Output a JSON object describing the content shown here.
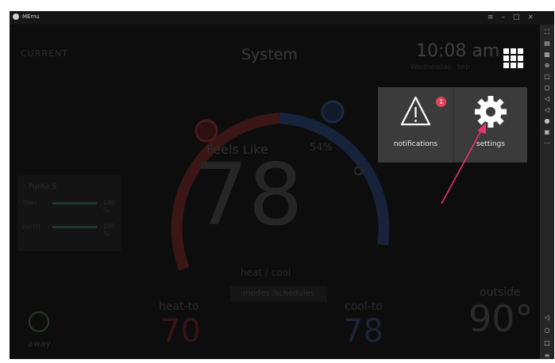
{
  "window": {
    "title": "MEmu",
    "controls": [
      "≡",
      "–",
      "□",
      "×"
    ]
  },
  "header": {
    "left_label": "CURRENT",
    "center_title": "System",
    "time": "10:08 am",
    "date": "Wednesday, Sep"
  },
  "thermostat": {
    "feels_like_label": "Feels Like",
    "humidity": "54%",
    "temperature": "78",
    "degree": "°",
    "mode": "heat / cool",
    "modes_button": "modes /schedules",
    "heat_to_label": "heat-to",
    "heat_to_value": "70",
    "cool_to_label": "cool-to",
    "cool_to_value": "78",
    "outside_label": "outside",
    "outside_value": "90°",
    "away_label": "away"
  },
  "purair_card": {
    "title": "PurAir S",
    "rows": [
      {
        "label": "filter",
        "value": "100",
        "unit": "%"
      },
      {
        "label": "pur(t)",
        "value": "100",
        "unit": "%"
      }
    ]
  },
  "popup_menu": {
    "notifications_label": "notifications",
    "notifications_badge": "1",
    "settings_label": "settings"
  },
  "colors": {
    "popup_bg": "#3b3b3b",
    "badge": "#e0455b",
    "arrow": "#e8336e",
    "heat_arc": "#4a1a1a",
    "cool_arc": "#1a2a3f"
  },
  "icons": {
    "grid": "grid-menu-icon",
    "notifications": "warning-triangle-icon",
    "settings": "gear-icon"
  }
}
